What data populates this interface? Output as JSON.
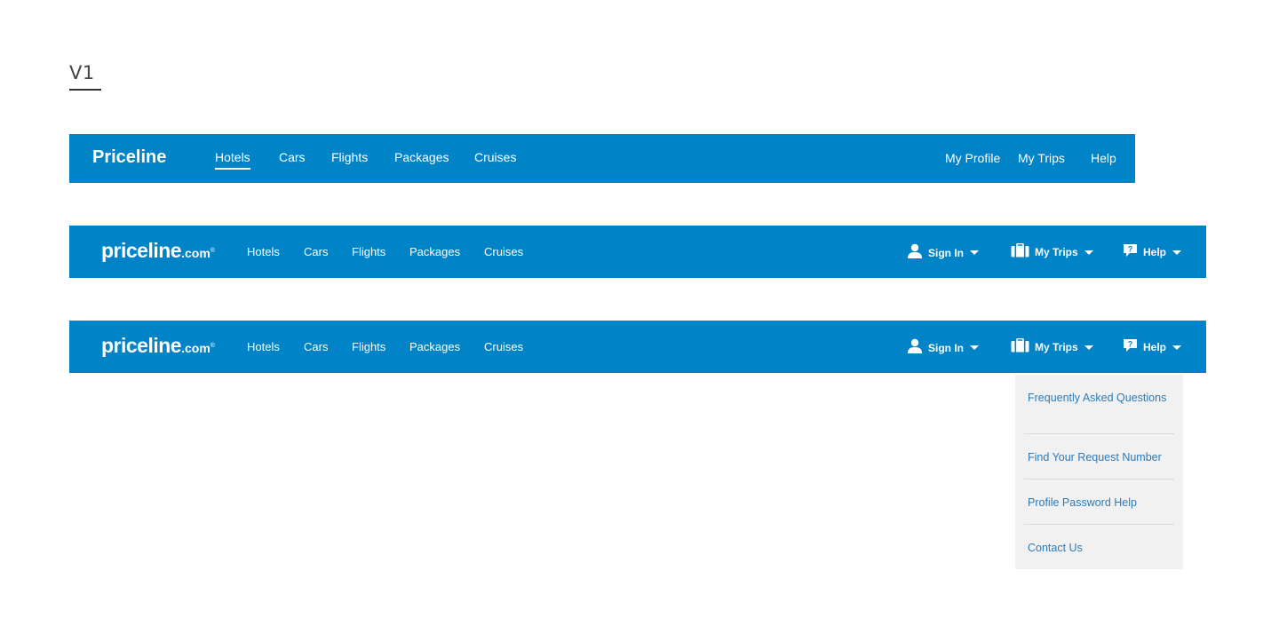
{
  "version_label": "V1",
  "bar1": {
    "brand": "Priceline",
    "nav": [
      "Hotels",
      "Cars",
      "Flights",
      "Packages",
      "Cruises"
    ],
    "active_nav": "Hotels",
    "right": [
      "My Profile",
      "My Trips",
      "Help"
    ]
  },
  "bar2": {
    "logo_main": "priceline",
    "logo_suffix": ".com",
    "logo_tm": "®",
    "nav": [
      "Hotels",
      "Cars",
      "Flights",
      "Packages",
      "Cruises"
    ],
    "right": [
      {
        "label": "Sign In",
        "icon": "user-icon"
      },
      {
        "label": "My Trips",
        "icon": "suitcase-icon"
      },
      {
        "label": "Help",
        "icon": "help-bubble-icon"
      }
    ]
  },
  "bar3": {
    "logo_main": "priceline",
    "logo_suffix": ".com",
    "logo_tm": "®",
    "nav": [
      "Hotels",
      "Cars",
      "Flights",
      "Packages",
      "Cruises"
    ],
    "right": [
      {
        "label": "Sign In",
        "icon": "user-icon"
      },
      {
        "label": "My Trips",
        "icon": "suitcase-icon"
      },
      {
        "label": "Help",
        "icon": "help-bubble-icon"
      }
    ]
  },
  "help_dropdown": {
    "items": [
      "Frequently Asked Questions",
      "Find Your Request Number",
      "Profile Password Help",
      "Contact Us"
    ]
  },
  "colors": {
    "bar": "#0183c7",
    "dropdown_bg": "#f1f1f1",
    "dropdown_link": "#2f7ab8"
  }
}
